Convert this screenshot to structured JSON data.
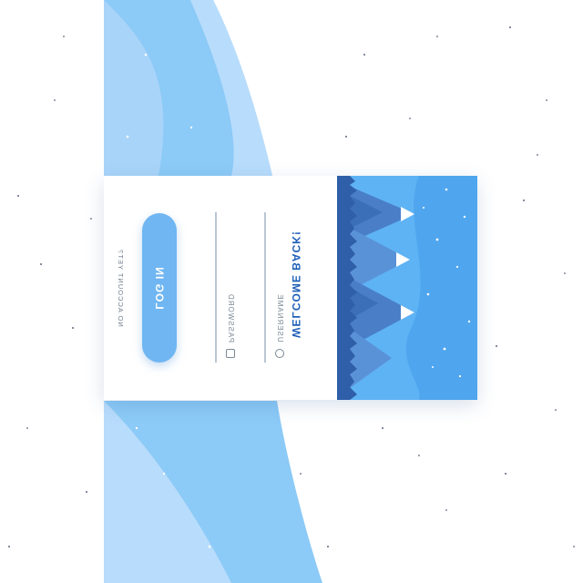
{
  "login": {
    "welcome_text": "WELCOME BACK!",
    "username_label": "USERNAME",
    "password_label": "PASSWORD",
    "login_button_label": "LOG IN",
    "no_account_text": "NO ACCOUNT YET?"
  },
  "icons": {
    "username": "user-icon",
    "password": "lock-icon"
  },
  "colors": {
    "accent": "#6fb6f2",
    "title": "#1e5fb8",
    "background_wave_light": "#b8dcfb",
    "background_wave": "#8ccaf7",
    "sky": "#5eb3f4"
  }
}
